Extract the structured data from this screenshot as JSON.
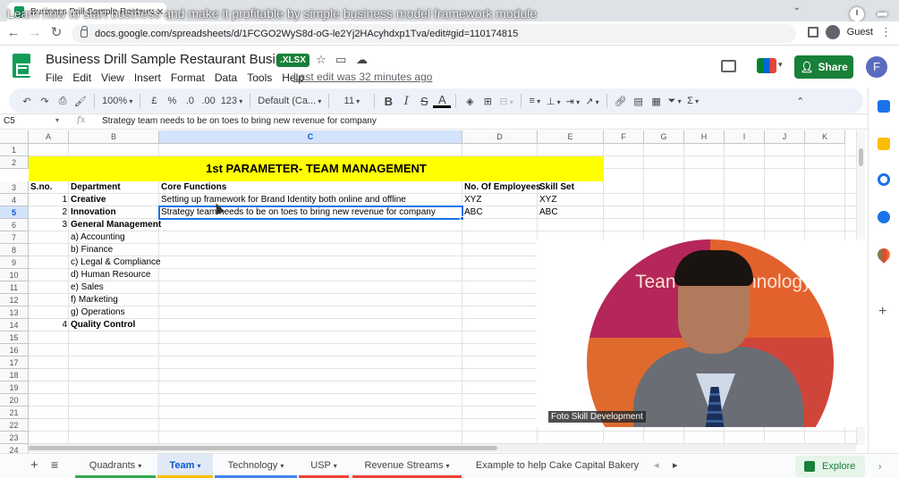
{
  "browser": {
    "tab_title": "Business Drill Sample Restaura",
    "video_title": "Learn how to start business and make it profitable by simple business model framework module",
    "url": "docs.google.com/spreadsheets/d/1FCGO2WyS8d-oG-le2Yj2HAcyhdxp1Tva/edit#gid=110174815",
    "profile_label": "Guest"
  },
  "doc": {
    "title": "Business Drill Sample Restaurant Business",
    "badge": ".XLSX",
    "menus": [
      "File",
      "Edit",
      "View",
      "Insert",
      "Format",
      "Data",
      "Tools",
      "Help"
    ],
    "last_edit": "Last edit was 32 minutes ago",
    "share_label": "Share",
    "avatar_letter": "F"
  },
  "toolbar": {
    "zoom": "100%",
    "currency": "£",
    "percent": "%",
    "dec_less": ".0",
    "dec_more": ".00",
    "format_more": "123",
    "font": "Default (Ca...",
    "font_size": "11",
    "bold": "B",
    "italic": "I",
    "strike": "S",
    "text_color": "A"
  },
  "formula_bar": {
    "cell_ref": "C5",
    "fx": "fx",
    "content": "Strategy team needs to be on toes to bring new revenue for company"
  },
  "sheet": {
    "columns": [
      "A",
      "B",
      "C",
      "D",
      "E",
      "F",
      "G",
      "H",
      "I",
      "J",
      "K"
    ],
    "rows": [
      "1",
      "2",
      "3",
      "4",
      "5",
      "6",
      "7",
      "8",
      "9",
      "10",
      "11",
      "12",
      "13",
      "14",
      "15",
      "16",
      "17",
      "18",
      "19",
      "20",
      "21",
      "22",
      "23",
      "24"
    ],
    "title": "1st PARAMETER- TEAM MANAGEMENT",
    "headers": {
      "sno": "S.no.",
      "department": "Department",
      "core": "Core Functions",
      "employees": "No. Of Employees",
      "skill": "Skill Set"
    },
    "r4": {
      "sno": "1",
      "dept": "Creative",
      "core": "Setting up framework for Brand Identity both online and offline",
      "emp": "XYZ",
      "skill": "XYZ"
    },
    "r5": {
      "sno": "2",
      "dept": "Innovation",
      "core": "Strategy team needs to be on toes to bring new revenue for company",
      "emp": "ABC",
      "skill": "ABC"
    },
    "r6": {
      "sno": "3",
      "dept": "General Management"
    },
    "sub_items": [
      "a) Accounting",
      "b) Finance",
      "c) Legal & Compliance",
      "d) Human Resource",
      "e) Sales",
      "f) Marketing",
      "g) Operations"
    ],
    "r14": {
      "sno": "4",
      "dept": "Quality Control"
    }
  },
  "sheet_tabs": [
    {
      "label": "Quadrants",
      "color": "#34a853"
    },
    {
      "label": "Team",
      "color": "#fbbc04"
    },
    {
      "label": "Technology",
      "color": "#4285f4"
    },
    {
      "label": "USP",
      "color": "#ea4335"
    },
    {
      "label": "Revenue Streams",
      "color": "#ea4335"
    },
    {
      "label": "Example to help Cake Capital Bakery",
      "color": ""
    }
  ],
  "explore_label": "Explore",
  "webcam": {
    "caption": "Foto Skill Development",
    "slide_left": "Tean",
    "slide_right": "hnology"
  },
  "colors": {
    "title_band": "#ffff00",
    "selection": "#1a73e8",
    "share": "#188038"
  }
}
